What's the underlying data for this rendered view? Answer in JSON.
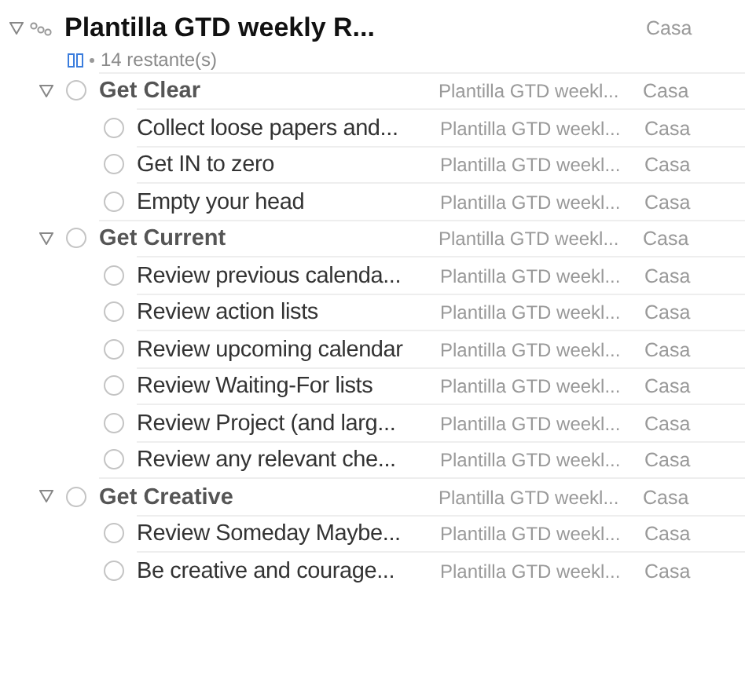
{
  "project": {
    "title": "Plantilla GTD weekly R...",
    "expanded": true,
    "remaining": "14 restante(s)",
    "context": "Casa"
  },
  "groups": [
    {
      "title": "Get Clear",
      "expanded": true,
      "project": "Plantilla GTD weekl...",
      "context": "Casa",
      "children": [
        {
          "title": "Collect loose papers and...",
          "project": "Plantilla GTD weekl...",
          "context": "Casa"
        },
        {
          "title": "Get IN to zero",
          "project": "Plantilla GTD weekl...",
          "context": "Casa"
        },
        {
          "title": "Empty your head",
          "project": "Plantilla GTD weekl...",
          "context": "Casa"
        }
      ]
    },
    {
      "title": "Get Current",
      "expanded": true,
      "project": "Plantilla GTD weekl...",
      "context": "Casa",
      "children": [
        {
          "title": "Review previous calenda...",
          "project": "Plantilla GTD weekl...",
          "context": "Casa"
        },
        {
          "title": "Review action lists",
          "project": "Plantilla GTD weekl...",
          "context": "Casa"
        },
        {
          "title": "Review upcoming calendar",
          "project": "Plantilla GTD weekl...",
          "context": "Casa"
        },
        {
          "title": "Review Waiting-For lists",
          "project": "Plantilla GTD weekl...",
          "context": "Casa"
        },
        {
          "title": "Review Project (and larg...",
          "project": "Plantilla GTD weekl...",
          "context": "Casa"
        },
        {
          "title": "Review any relevant che...",
          "project": "Plantilla GTD weekl...",
          "context": "Casa"
        }
      ]
    },
    {
      "title": "Get Creative",
      "expanded": true,
      "project": "Plantilla GTD weekl...",
      "context": "Casa",
      "children": [
        {
          "title": "Review Someday Maybe...",
          "project": "Plantilla GTD weekl...",
          "context": "Casa"
        },
        {
          "title": "Be creative and courage...",
          "project": "Plantilla GTD weekl...",
          "context": "Casa"
        }
      ]
    }
  ]
}
